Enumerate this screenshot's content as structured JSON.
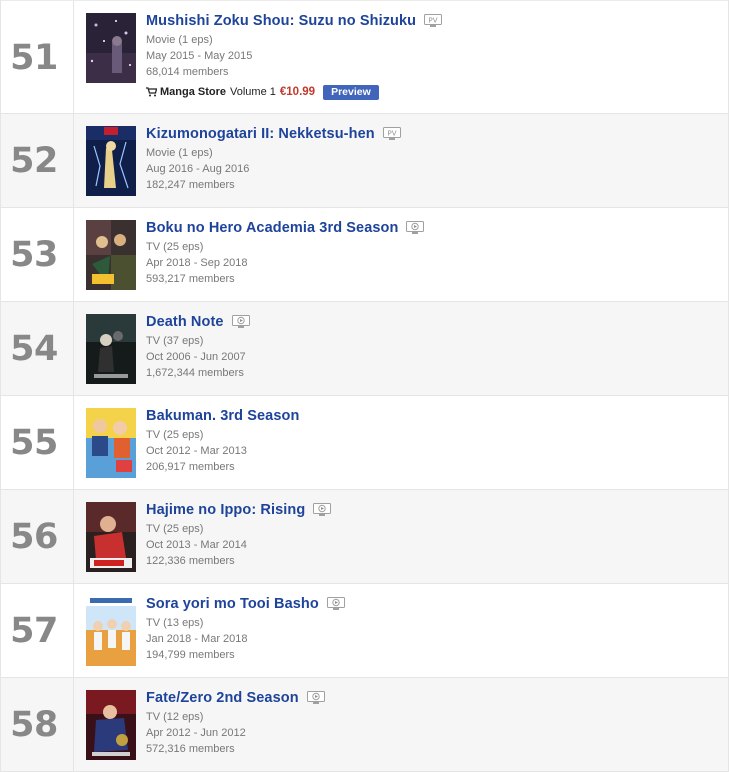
{
  "store": {
    "label": "Manga Store",
    "volume": "Volume 1",
    "price": "€10.99",
    "preview": "Preview"
  },
  "rows": [
    {
      "rank": "51",
      "title": "Mushishi Zoku Shou: Suzu no Shizuku",
      "type": "Movie (1 eps)",
      "aired": "May 2015 - May 2015",
      "members": "68,014 members",
      "badge": "PV"
    },
    {
      "rank": "52",
      "title": "Kizumonogatari II: Nekketsu-hen",
      "type": "Movie (1 eps)",
      "aired": "Aug 2016 - Aug 2016",
      "members": "182,247 members",
      "badge": "PV"
    },
    {
      "rank": "53",
      "title": "Boku no Hero Academia 3rd Season",
      "type": "TV (25 eps)",
      "aired": "Apr 2018 - Sep 2018",
      "members": "593,217 members",
      "badge": "play"
    },
    {
      "rank": "54",
      "title": "Death Note",
      "type": "TV (37 eps)",
      "aired": "Oct 2006 - Jun 2007",
      "members": "1,672,344 members",
      "badge": "play"
    },
    {
      "rank": "55",
      "title": "Bakuman. 3rd Season",
      "type": "TV (25 eps)",
      "aired": "Oct 2012 - Mar 2013",
      "members": "206,917 members",
      "badge": "none"
    },
    {
      "rank": "56",
      "title": "Hajime no Ippo: Rising",
      "type": "TV (25 eps)",
      "aired": "Oct 2013 - Mar 2014",
      "members": "122,336 members",
      "badge": "play"
    },
    {
      "rank": "57",
      "title": "Sora yori mo Tooi Basho",
      "type": "TV (13 eps)",
      "aired": "Jan 2018 - Mar 2018",
      "members": "194,799 members",
      "badge": "play"
    },
    {
      "rank": "58",
      "title": "Fate/Zero 2nd Season",
      "type": "TV (12 eps)",
      "aired": "Apr 2012 - Jun 2012",
      "members": "572,316 members",
      "badge": "play"
    }
  ]
}
